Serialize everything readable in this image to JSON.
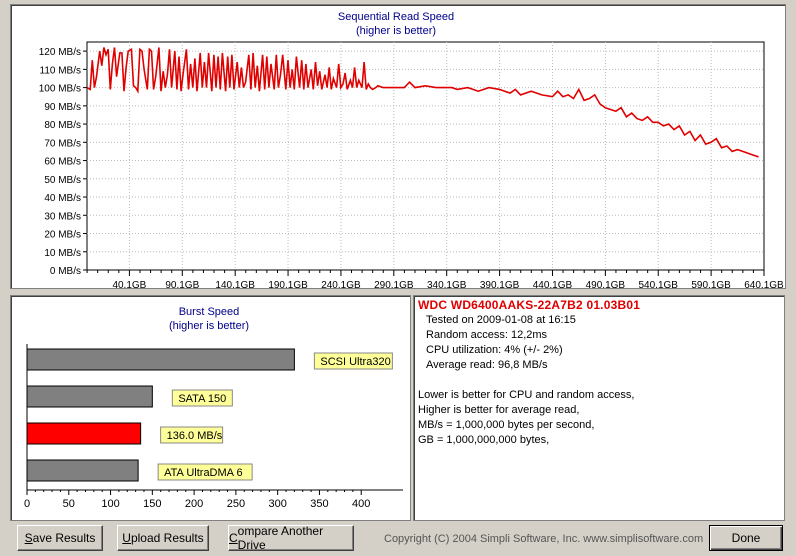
{
  "seq_chart": {
    "chart_data": {
      "type": "line",
      "title": "Sequential Read Speed",
      "subtitle": "(higher is better)",
      "xlabel": "",
      "ylabel": "",
      "y_unit": "MB/s",
      "ylim": [
        0,
        125
      ],
      "xlim": [
        0,
        640.1
      ],
      "y_ticks": [
        0,
        10,
        20,
        30,
        40,
        50,
        60,
        70,
        80,
        90,
        100,
        110,
        120
      ],
      "y_tick_labels": [
        "0 MB/s",
        "10 MB/s",
        "20 MB/s",
        "30 MB/s",
        "40 MB/s",
        "50 MB/s",
        "60 MB/s",
        "70 MB/s",
        "80 MB/s",
        "90 MB/s",
        "100 MB/s",
        "110 MB/s",
        "120 MB/s"
      ],
      "x_tick_labels": [
        "40.1GB",
        "90.1GB",
        "140.1GB",
        "190.1GB",
        "240.1GB",
        "290.1GB",
        "340.1GB",
        "390.1GB",
        "440.1GB",
        "490.1GB",
        "540.1GB",
        "590.1GB",
        "640.1GB"
      ],
      "x_ticks": [
        40.1,
        90.1,
        140.1,
        190.1,
        240.1,
        290.1,
        340.1,
        390.1,
        440.1,
        490.1,
        540.1,
        590.1,
        640.1
      ],
      "grid": true,
      "series": [
        {
          "color": "#e00000",
          "x": [
            0,
            3,
            5,
            7,
            9,
            12,
            14,
            16,
            18,
            20,
            22,
            24,
            26,
            28,
            31,
            33,
            35,
            37,
            39,
            42,
            44,
            46,
            48,
            50,
            52,
            54,
            57,
            59,
            61,
            63,
            65,
            68,
            70,
            72,
            74,
            76,
            78,
            80,
            83,
            85,
            87,
            89,
            91,
            94,
            96,
            98,
            100,
            102,
            104,
            107,
            109,
            111,
            113,
            115,
            118,
            120,
            122,
            124,
            126,
            128,
            131,
            133,
            135,
            137,
            139,
            142,
            144,
            146,
            148,
            150,
            153,
            155,
            157,
            159,
            161,
            163,
            166,
            168,
            170,
            172,
            174,
            177,
            179,
            181,
            183,
            185,
            188,
            190,
            192,
            194,
            196,
            198,
            201,
            203,
            205,
            207,
            209,
            212,
            214,
            216,
            218,
            220,
            222,
            225,
            227,
            229,
            231,
            233,
            236,
            238,
            240,
            242,
            244,
            246,
            249,
            251,
            253,
            255,
            257,
            260,
            262,
            264,
            266,
            268,
            270,
            273,
            275,
            280,
            290,
            300,
            305,
            310,
            320,
            330,
            340,
            345,
            350,
            360,
            370,
            380,
            390,
            400,
            405,
            410,
            420,
            430,
            440,
            445,
            450,
            455,
            460,
            465,
            470,
            475,
            480,
            485,
            490,
            495,
            500,
            505,
            510,
            515,
            520,
            525,
            530,
            535,
            540,
            545,
            550,
            555,
            560,
            565,
            570,
            575,
            580,
            585,
            590,
            595,
            600,
            605,
            610,
            615,
            620,
            625,
            630,
            635,
            640
          ],
          "y": [
            100,
            99,
            115,
            100,
            106,
            120,
            112,
            122,
            118,
            121,
            99,
            113,
            122,
            106,
            119,
            119,
            98,
            111,
            120,
            121,
            101,
            100,
            98,
            121,
            120,
            110,
            99,
            121,
            120,
            99,
            106,
            122,
            98,
            109,
            100,
            107,
            121,
            100,
            120,
            99,
            117,
            98,
            108,
            121,
            99,
            113,
            100,
            116,
            98,
            119,
            100,
            114,
            100,
            119,
            98,
            118,
            100,
            117,
            99,
            119,
            98,
            117,
            100,
            118,
            99,
            114,
            100,
            111,
            100,
            103,
            118,
            99,
            119,
            100,
            112,
            98,
            118,
            99,
            117,
            100,
            113,
            99,
            118,
            100,
            107,
            118,
            99,
            115,
            100,
            110,
            99,
            117,
            100,
            115,
            99,
            113,
            100,
            110,
            99,
            114,
            101,
            109,
            99,
            107,
            100,
            111,
            99,
            105,
            100,
            113,
            100,
            102,
            108,
            99,
            104,
            100,
            111,
            100,
            104,
            100,
            114,
            99,
            102,
            100,
            99,
            100,
            101,
            100,
            100,
            100,
            103,
            100,
            101,
            100,
            100,
            100,
            99,
            100,
            98,
            100,
            99,
            97,
            99,
            96,
            98,
            96,
            95,
            98,
            95,
            96,
            94,
            99,
            93,
            94,
            96,
            91,
            89,
            88,
            87,
            89,
            84,
            86,
            83,
            82,
            84,
            81,
            81,
            79,
            80,
            77,
            79,
            74,
            76,
            71,
            74,
            69,
            70,
            72,
            67,
            68,
            65,
            66,
            65,
            64,
            63,
            62
          ]
        }
      ]
    }
  },
  "burst_chart": {
    "chart_data": {
      "type": "bar",
      "orientation": "horizontal",
      "title": "Burst Speed",
      "subtitle": "(higher is better)",
      "xlim": [
        0,
        450
      ],
      "x_ticks": [
        0,
        50,
        100,
        150,
        200,
        250,
        300,
        350,
        400
      ],
      "x_tick_labels": [
        "0",
        "50",
        "100",
        "150",
        "200",
        "250",
        "300",
        "350",
        "400"
      ],
      "grid": false,
      "bars": [
        {
          "label": "SCSI Ultra320",
          "value": 320,
          "color": "#808080"
        },
        {
          "label": "SATA 150",
          "value": 150,
          "color": "#808080"
        },
        {
          "label": "136.0 MB/s",
          "value": 136,
          "color": "#ff0000"
        },
        {
          "label": "ATA UltraDMA 6",
          "value": 133,
          "color": "#808080"
        }
      ]
    }
  },
  "info": {
    "drive_name": "WDC  WD6400AAKS-22A7B2  01.03B01",
    "tested_on": "Tested on 2009-01-08 at 16:15",
    "random_access": "Random access: 12,2ms",
    "cpu_util": "CPU utilization: 4% (+/- 2%)",
    "avg_read": "Average read: 96,8 MB/s",
    "notes": [
      "Lower is better for CPU and random access,",
      "Higher is better for average read,",
      "MB/s = 1,000,000 bytes per second,",
      "GB = 1,000,000,000 bytes,"
    ]
  },
  "buttons": {
    "save_u": "S",
    "save_rest": "ave Results",
    "upload_u": "U",
    "upload_rest": "pload Results",
    "compare_u": "C",
    "compare_rest": "ompare Another Drive",
    "done": "Done"
  },
  "copyright": "Copyright (C) 2004 Simpli Software, Inc. www.simplisoftware.com"
}
